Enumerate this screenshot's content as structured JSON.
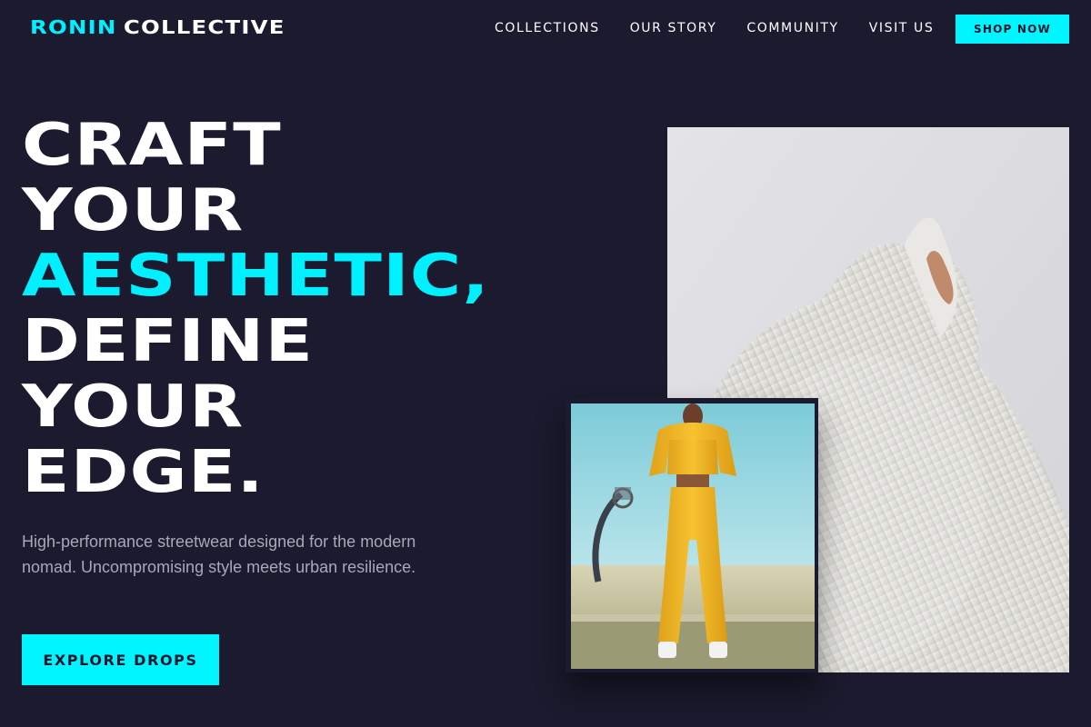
{
  "nav": {
    "brand_accent": "RONIN",
    "brand_rest": "COLLECTIVE",
    "links": [
      {
        "label": "COLLECTIONS"
      },
      {
        "label": "OUR STORY"
      },
      {
        "label": "COMMUNITY"
      },
      {
        "label": "VISIT US"
      }
    ],
    "shop_label": "SHOP NOW"
  },
  "hero": {
    "headline_lines": [
      "CRAFT",
      "YOUR",
      "AESTHETIC,",
      "DEFINE",
      "YOUR",
      "EDGE."
    ],
    "highlight_line_index": 2,
    "subtext": "High-performance streetwear designed for the modern nomad. Uncompromising style meets urban resilience.",
    "cta_label": "EXPLORE DROPS"
  },
  "images": {
    "large": {
      "subject": "model in oversized white knit sweater"
    },
    "small": {
      "subject": "model in yellow cropped hoodie and joggers at basketball court"
    }
  },
  "colors": {
    "background": "#1b1a2e",
    "accent": "#00f5ff",
    "text": "#ffffff",
    "muted": "#a9a8ba"
  }
}
